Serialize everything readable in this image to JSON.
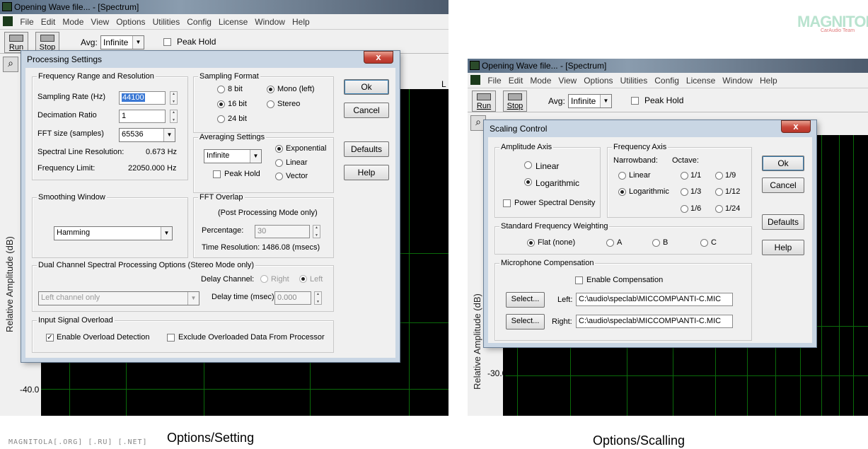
{
  "left": {
    "window_title": "Opening Wave file... - [Spectrum]",
    "menu": [
      "File",
      "Edit",
      "Mode",
      "View",
      "Options",
      "Utilities",
      "Config",
      "License",
      "Window",
      "Help"
    ],
    "run_label": "Run",
    "stop_label": "Stop",
    "avg_label": "Avg:",
    "avg_value": "Infinite",
    "peak_hold_label": "Peak Hold",
    "ylabel": "Relative Amplitude (dB)",
    "y_tick": "-40.0",
    "dialog": {
      "title": "Processing Settings",
      "close": "x",
      "freq_group": "Frequency Range and Resolution",
      "sampling_rate_label": "Sampling Rate (Hz)",
      "sampling_rate_value": "44100",
      "decimation_label": "Decimation Ratio",
      "decimation_value": "1",
      "fft_size_label": "FFT size (samples)",
      "fft_size_value": "65536",
      "spectral_res_label": "Spectral Line Resolution:",
      "spectral_res_value": "0.673 Hz",
      "freq_limit_label": "Frequency Limit:",
      "freq_limit_value": "22050.000 Hz",
      "sampling_format_group": "Sampling Format",
      "bit8": "8 bit",
      "bit16": "16 bit",
      "bit24": "24 bit",
      "mono_left": "Mono (left)",
      "stereo": "Stereo",
      "averaging_group": "Averaging Settings",
      "averaging_value": "Infinite",
      "exponential": "Exponential",
      "linear": "Linear",
      "vector": "Vector",
      "peak_hold": "Peak Hold",
      "smoothing_group": "Smoothing Window",
      "smoothing_value": "Hamming",
      "fft_overlap_group": "FFT Overlap",
      "post_processing_note": "(Post Processing Mode only)",
      "percentage_label": "Percentage:",
      "percentage_value": "30",
      "time_resolution": "Time Resolution: 1486.08 (msecs)",
      "dual_group": "Dual Channel Spectral Processing Options (Stereo Mode only)",
      "delay_channel_label": "Delay Channel:",
      "delay_right": "Right",
      "delay_left": "Left",
      "channel_value": "Left channel only",
      "delay_time_label": "Delay time (msec):",
      "delay_time_value": "0.000",
      "overload_group": "Input Signal Overload",
      "enable_overload": "Enable Overload Detection",
      "exclude_overload": "Exclude Overloaded Data From Processor",
      "ok": "Ok",
      "cancel": "Cancel",
      "defaults": "Defaults",
      "help": "Help"
    },
    "caption": "Options/Setting"
  },
  "right": {
    "window_title": "Opening Wave file... - [Spectrum]",
    "menu": [
      "File",
      "Edit",
      "Mode",
      "View",
      "Options",
      "Utilities",
      "Config",
      "License",
      "Window",
      "Help"
    ],
    "run_label": "Run",
    "stop_label": "Stop",
    "avg_label": "Avg:",
    "avg_value": "Infinite",
    "peak_hold_label": "Peak Hold",
    "ylabel": "Relative Amplitude (dB)",
    "y_tick": "-30.0",
    "dialog": {
      "title": "Scaling Control",
      "close": "x",
      "amp_group": "Amplitude Axis",
      "linear": "Linear",
      "logarithmic": "Logarithmic",
      "psd": "Power Spectral Density",
      "freq_group": "Frequency Axis",
      "narrowband": "Narrowband:",
      "octave": "Octave:",
      "nb_linear": "Linear",
      "nb_log": "Logarithmic",
      "oct_1_1": "1/1",
      "oct_1_3": "1/3",
      "oct_1_6": "1/6",
      "oct_1_9": "1/9",
      "oct_1_12": "1/12",
      "oct_1_24": "1/24",
      "weighting_group": "Standard Frequency Weighting",
      "flat": "Flat (none)",
      "wa": "A",
      "wb": "B",
      "wc": "C",
      "mic_group": "Microphone Compensation",
      "enable_comp": "Enable Compensation",
      "select": "Select...",
      "left_label": "Left:",
      "left_path": "C:\\audio\\speclab\\MICCOMP\\ANTI-C.MIC",
      "right_label": "Right:",
      "right_path": "C:\\audio\\speclab\\MICCOMP\\ANTI-C.MIC",
      "ok": "Ok",
      "cancel": "Cancel",
      "defaults": "Defaults",
      "help": "Help"
    },
    "caption": "Options/Scalling"
  },
  "watermark": "MAGNITOLA[.ORG] [.RU] [.NET]",
  "logo_text": "MAGNITOLA",
  "logo_sub": "CarAudio Team"
}
